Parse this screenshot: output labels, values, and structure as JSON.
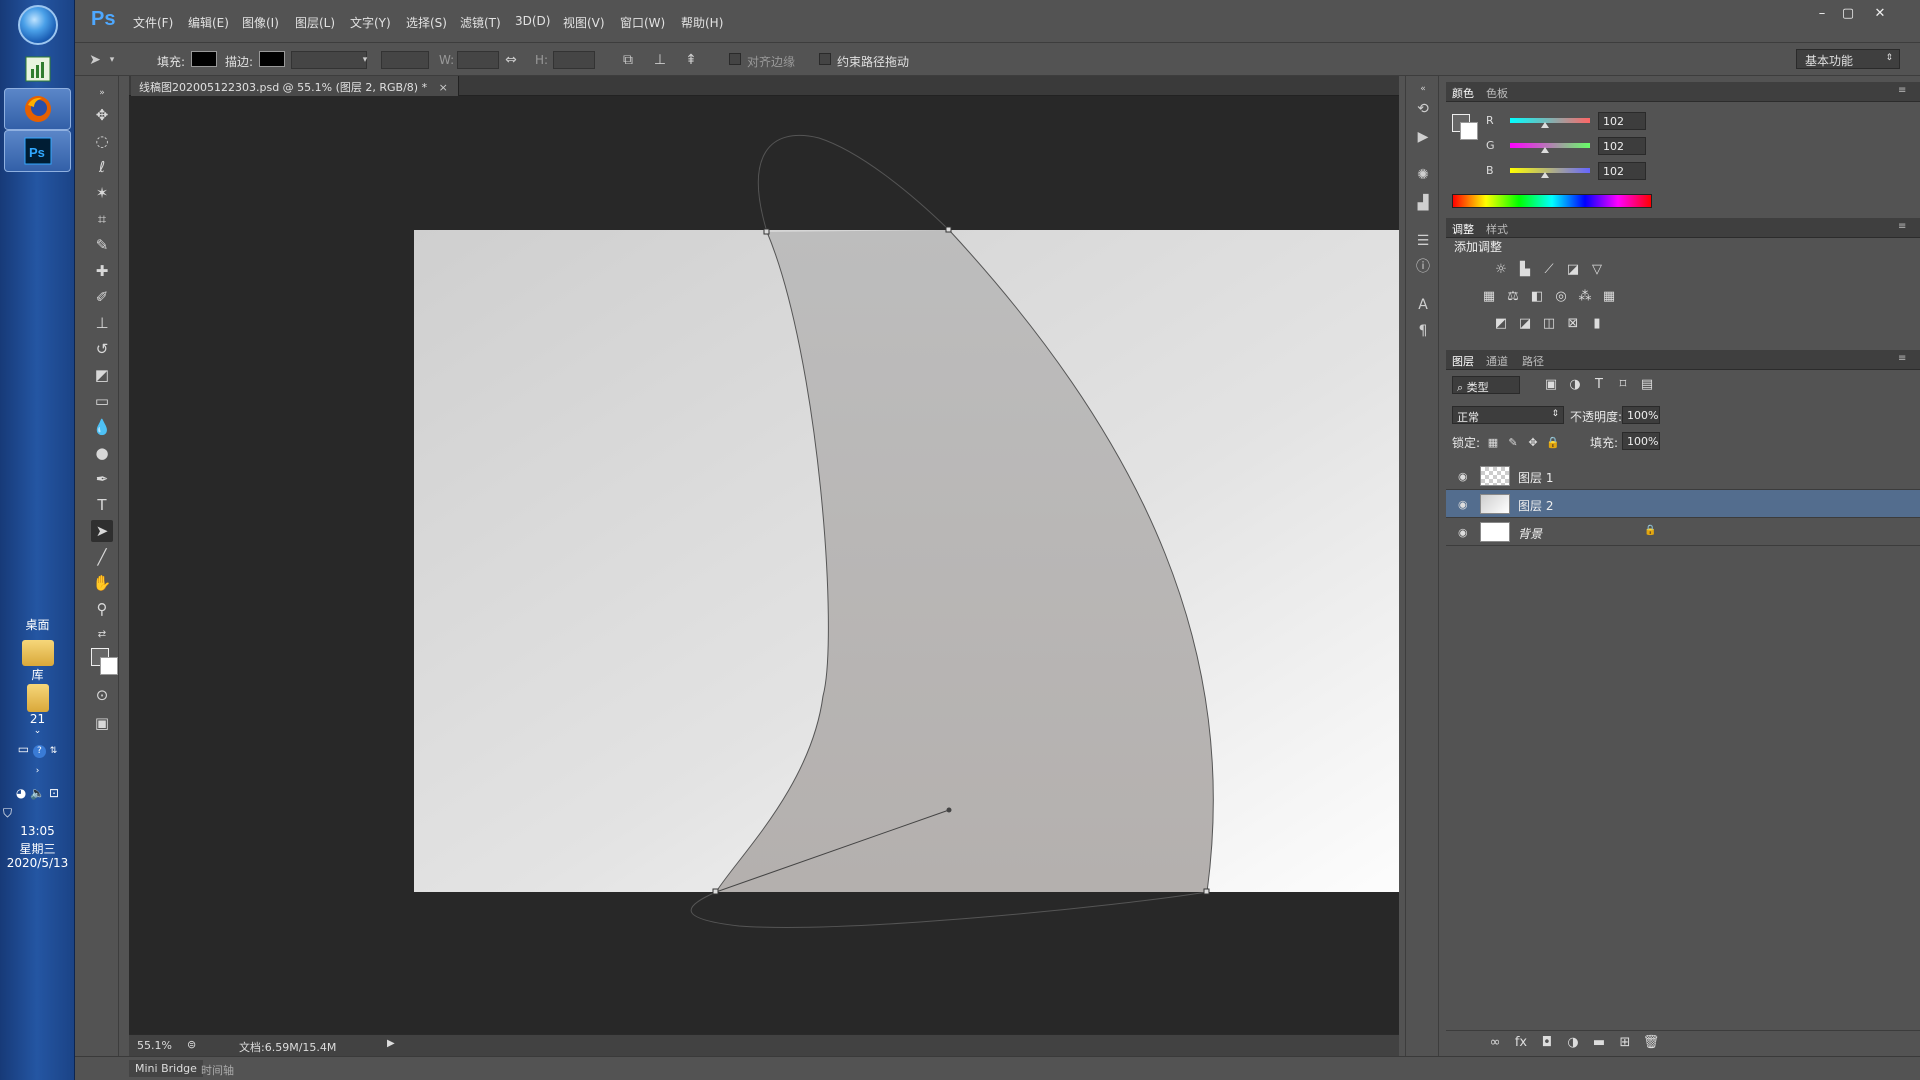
{
  "taskbar": {
    "desktop_label": "桌面",
    "library_label": "库",
    "folder_label": "21",
    "clock_time": "13:05",
    "clock_day": "星期三",
    "clock_date": "2020/5/13"
  },
  "app": {
    "logo": "Ps",
    "menu": [
      "文件(F)",
      "编辑(E)",
      "图像(I)",
      "图层(L)",
      "文字(Y)",
      "选择(S)",
      "滤镜(T)",
      "3D(D)",
      "视图(V)",
      "窗口(W)",
      "帮助(H)"
    ],
    "window_controls": [
      "–",
      "▢",
      "✕"
    ]
  },
  "options": {
    "fill_label": "填充:",
    "stroke_label": "描边:",
    "w_label": "W:",
    "h_label": "H:",
    "align_edges_label": "对齐边缘",
    "constrain_path_label": "约束路径拖动",
    "workspace": "基本功能"
  },
  "document": {
    "tab_title": "线稿图202005122303.psd @ 55.1% (图层 2, RGB/8) *",
    "tab_close": "×",
    "zoom": "55.1%",
    "doc_info": "文档:6.59M/15.4M"
  },
  "bottom_tabs": [
    "Mini Bridge",
    "时间轴"
  ],
  "color_panel": {
    "tabs": [
      "颜色",
      "色板"
    ],
    "r_label": "R",
    "g_label": "G",
    "b_label": "B",
    "r": "102",
    "g": "102",
    "b": "102"
  },
  "adjust_panel": {
    "tabs": [
      "调整",
      "样式"
    ],
    "title": "添加调整"
  },
  "layers_panel": {
    "tabs": [
      "图层",
      "通道",
      "路径"
    ],
    "filter": "类型",
    "blend_mode": "正常",
    "opacity_label": "不透明度:",
    "opacity": "100%",
    "lock_label": "锁定:",
    "fill_label": "填充:",
    "fill": "100%",
    "layers": [
      {
        "name": "图层 1"
      },
      {
        "name": "图层 2"
      },
      {
        "name": "背景"
      }
    ]
  },
  "colors": {
    "accent": "#4ea8ff",
    "selected_layer": "#536d8e",
    "canvas_bg": "#282828"
  }
}
